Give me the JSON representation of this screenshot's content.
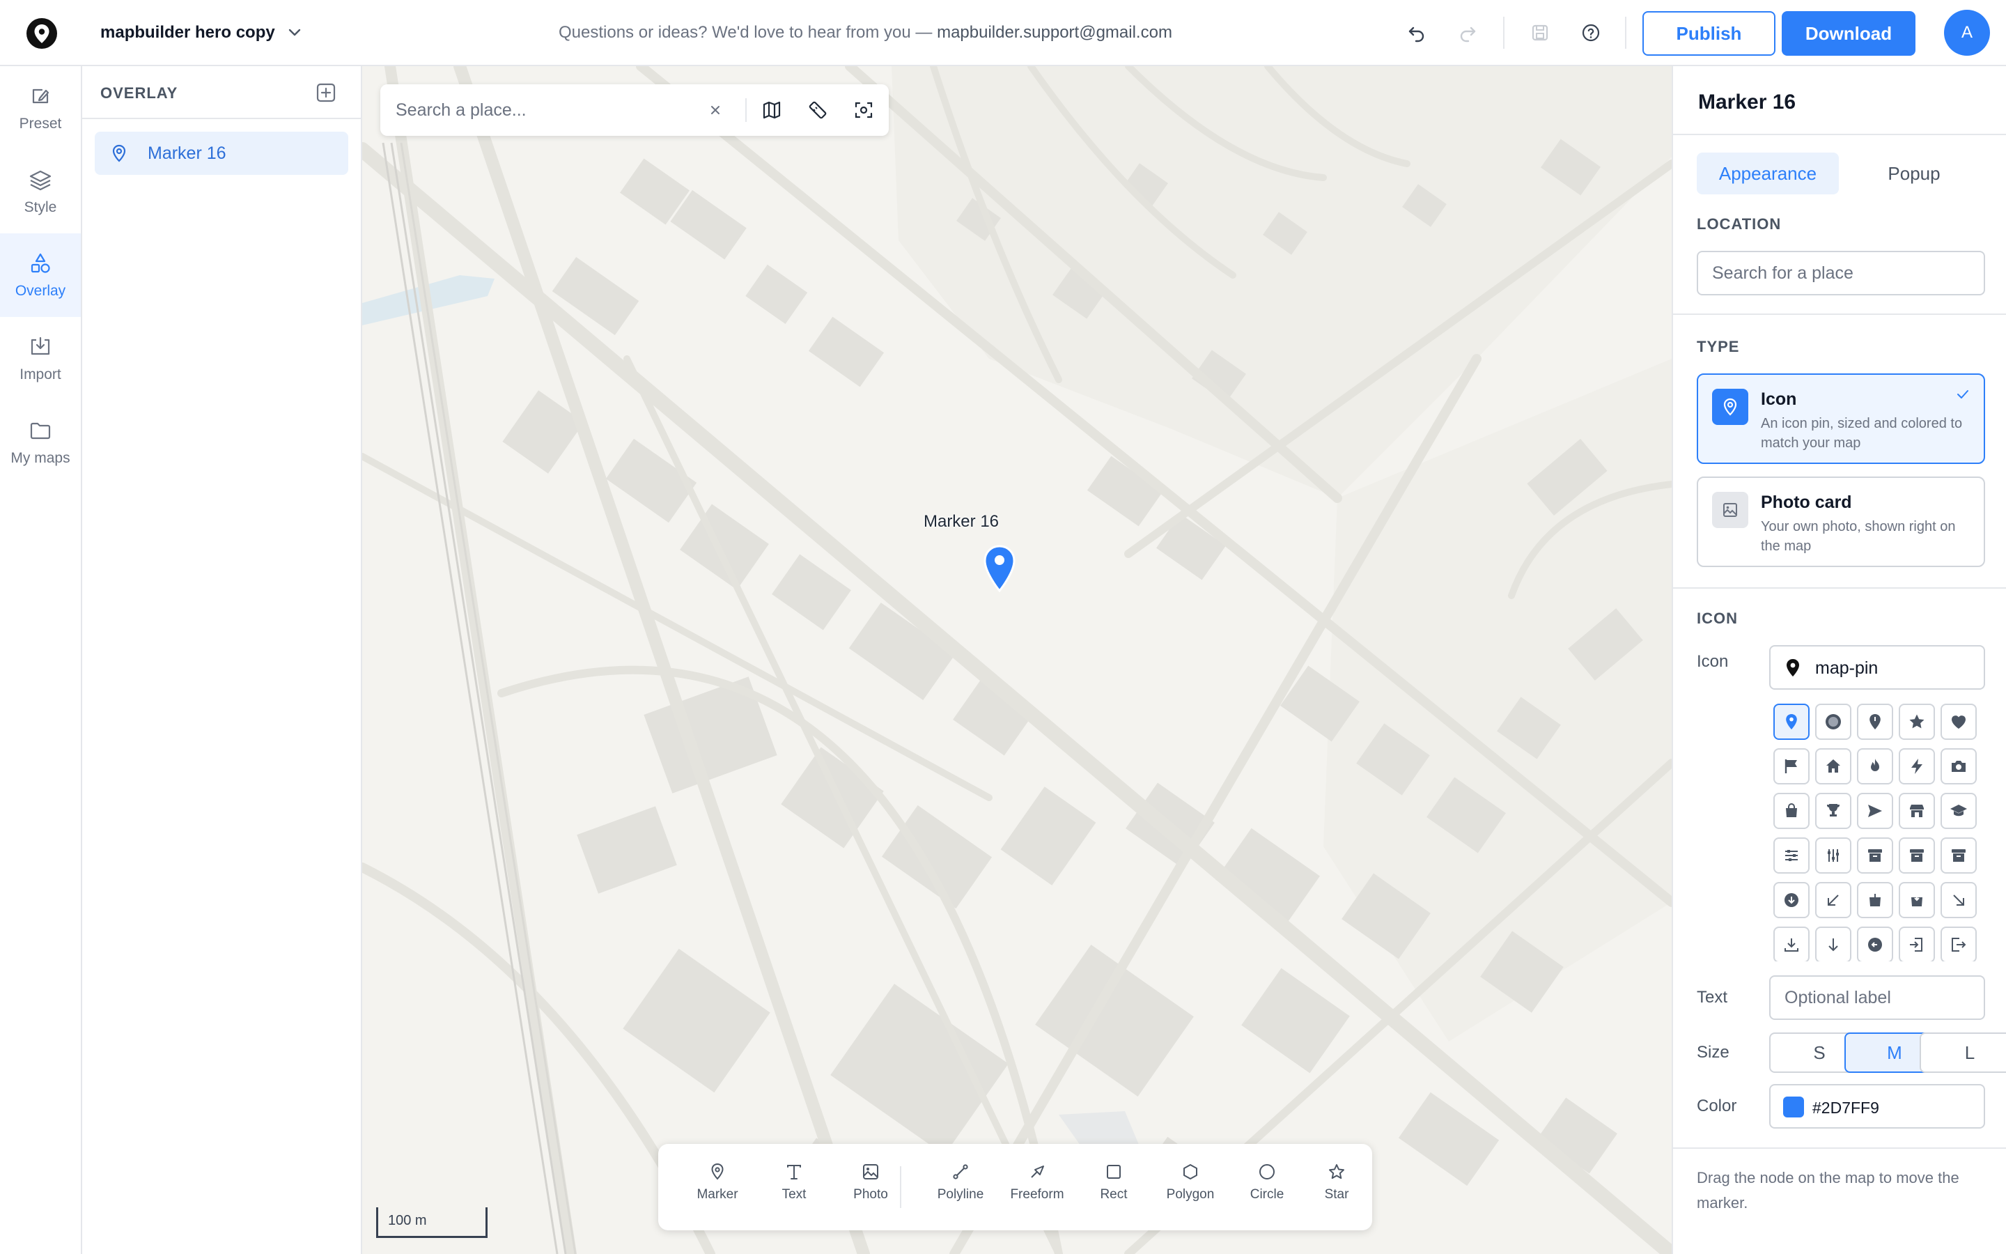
{
  "header": {
    "project_name": "mapbuilder hero copy",
    "feedback_text": "Questions or ideas? We'd love to hear from you — ",
    "feedback_email": "mapbuilder.support@gmail.com",
    "publish_label": "Publish",
    "download_label": "Download",
    "avatar_initial": "A"
  },
  "rail": {
    "items": [
      {
        "label": "Preset",
        "icon": "preset-icon"
      },
      {
        "label": "Style",
        "icon": "layers-icon"
      },
      {
        "label": "Overlay",
        "icon": "shapes-icon",
        "active": true
      },
      {
        "label": "Import",
        "icon": "import-icon"
      },
      {
        "label": "My maps",
        "icon": "folder-icon"
      }
    ]
  },
  "overlay": {
    "title": "OVERLAY",
    "items": [
      {
        "label": "Marker 16",
        "icon": "map-pin-icon",
        "selected": true
      }
    ]
  },
  "map": {
    "search_placeholder": "Search a place...",
    "marker_label": "Marker 16",
    "marker_color": "#2D7FF9",
    "scale_label": "100 m",
    "tools": [
      {
        "label": "Marker",
        "icon": "map-pin-icon"
      },
      {
        "label": "Text",
        "icon": "text-icon"
      },
      {
        "label": "Photo",
        "icon": "image-icon"
      },
      {
        "label": "Polyline",
        "icon": "polyline-icon"
      },
      {
        "label": "Freeform",
        "icon": "freeform-icon"
      },
      {
        "label": "Rect",
        "icon": "rect-icon"
      },
      {
        "label": "Polygon",
        "icon": "polygon-icon"
      },
      {
        "label": "Circle",
        "icon": "circle-icon"
      },
      {
        "label": "Star",
        "icon": "star-icon"
      }
    ]
  },
  "panel": {
    "title": "Marker 16",
    "tabs": [
      {
        "label": "Appearance",
        "active": true
      },
      {
        "label": "Popup",
        "active": false
      }
    ],
    "location_section": "LOCATION",
    "location_placeholder": "Search for a place",
    "type_section": "TYPE",
    "type_options": [
      {
        "title": "Icon",
        "desc": "An icon pin, sized and colored to match your map",
        "selected": true
      },
      {
        "title": "Photo card",
        "desc": "Your own photo, shown right on the map",
        "selected": false
      }
    ],
    "icon_section": "ICON",
    "icon_label": "Icon",
    "icon_value": "map-pin",
    "icon_grid": [
      "map-pin",
      "circle-dot",
      "pin-badge",
      "star",
      "heart",
      "flag",
      "home",
      "fire",
      "bolt",
      "camera",
      "bag",
      "trophy",
      "send",
      "store",
      "graduation-cap",
      "sliders-h",
      "sliders-v",
      "archive",
      "archive-box",
      "archive-alt",
      "circle-down",
      "arrow-down-left",
      "download-bag",
      "save-bag",
      "arrow-down-right",
      "download",
      "arrow-down",
      "circle-left",
      "enter",
      "exit"
    ],
    "text_label": "Text",
    "text_placeholder": "Optional label",
    "size_label": "Size",
    "sizes": [
      "S",
      "M",
      "L"
    ],
    "size_selected": "M",
    "color_label": "Color",
    "color_value": "#2D7FF9",
    "hint": "Drag the node on the map to move the marker."
  }
}
